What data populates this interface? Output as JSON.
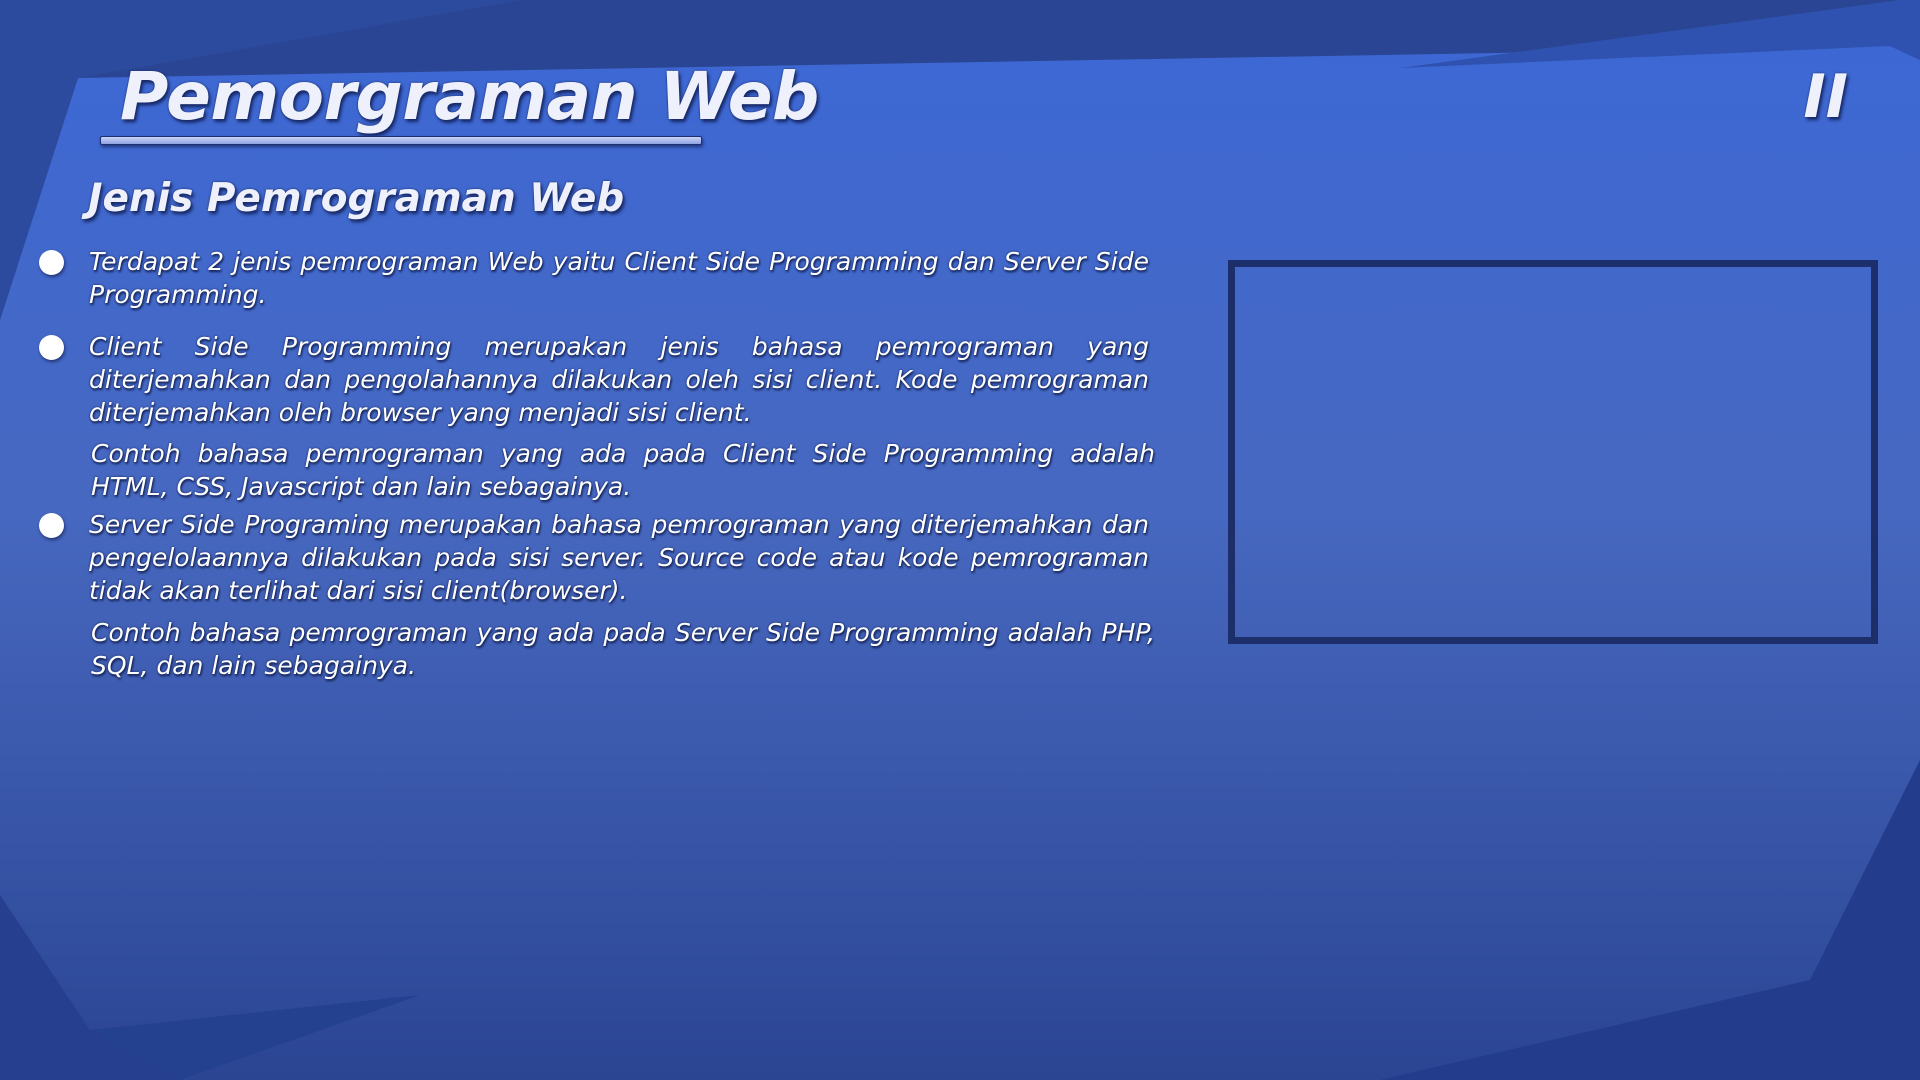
{
  "slide": {
    "title": "Pemorgraman Web",
    "page_mark": "II",
    "subtitle": "Jenis Pemrograman Web"
  },
  "content": {
    "points": [
      {
        "text": "Terdapat 2 jenis pemrograman Web yaitu Client Side Programming dan Server Side Programming."
      },
      {
        "text": "Client Side Programming merupakan jenis bahasa pemrograman yang diterjemahkan dan  pengolahannya dilakukan oleh sisi client. Kode pemrograman diterjemahkan oleh browser yang menjadi sisi client."
      },
      {
        "text": "Server Side Programing merupakan bahasa pemrograman yang diterjemahkan dan pengelolaannya dilakukan pada sisi server. Source code atau kode pemrograman tidak akan terlihat dari sisi client(browser)."
      }
    ],
    "examples": [
      {
        "text": "Contoh bahasa pemrograman yang ada pada Client Side Programming adalah HTML, CSS, Javascript dan lain sebagainya."
      },
      {
        "text": "Contoh bahasa pemrograman yang ada pada Server Side Programming adalah PHP, SQL, dan lain sebagainya."
      }
    ]
  },
  "theme": {
    "background_top": "#3d68d4",
    "background_bottom": "#2b4593",
    "shape_dark": "#233d8c",
    "frame_border": "#1c2f6b",
    "text": "#ffffff"
  }
}
